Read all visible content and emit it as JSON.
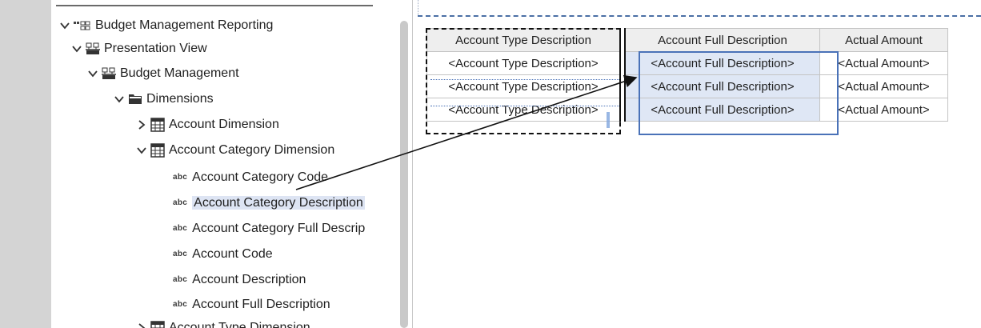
{
  "tree": {
    "items": [
      {
        "label": "Budget Management Reporting",
        "icon": "package-icon",
        "expanded": true
      },
      {
        "label": "Presentation View",
        "icon": "hierarchy-icon",
        "expanded": true
      },
      {
        "label": "Budget Management",
        "icon": "hierarchy-icon",
        "expanded": true
      },
      {
        "label": "Dimensions",
        "icon": "folder-icon",
        "expanded": true
      },
      {
        "label": "Account Dimension",
        "icon": "dimension-icon",
        "expanded": false
      },
      {
        "label": "Account Category Dimension",
        "icon": "dimension-icon",
        "expanded": true
      },
      {
        "label": "Account Category Code",
        "icon": "abc-icon"
      },
      {
        "label": "Account Category Description",
        "icon": "abc-icon",
        "selected": true
      },
      {
        "label": "Account Category Full Descrip",
        "icon": "abc-icon"
      },
      {
        "label": "Account Code",
        "icon": "abc-icon"
      },
      {
        "label": "Account Description",
        "icon": "abc-icon"
      },
      {
        "label": "Account Full Description",
        "icon": "abc-icon"
      },
      {
        "label": "Account Type Dimension",
        "icon": "dimension-icon",
        "expanded": false
      }
    ],
    "abc_glyph": "abc"
  },
  "report": {
    "headers": [
      "Account Type Description",
      "Account Full Description",
      "Actual Amount"
    ],
    "rows": [
      [
        "<Account Type Description>",
        "<Account Full Description>",
        "<Actual Amount>"
      ],
      [
        "<Account Type Description>",
        "<Account Full Description>",
        "<Actual Amount>"
      ],
      [
        "<Account Type Description>",
        "<Account Full Description>",
        "<Actual Amount>"
      ]
    ]
  },
  "colors": {
    "selection_blue": "#4a72b8",
    "selected_item_bg": "#dde4f3",
    "header_bg": "#eeeeee",
    "left_rail": "#d4d4d4"
  }
}
